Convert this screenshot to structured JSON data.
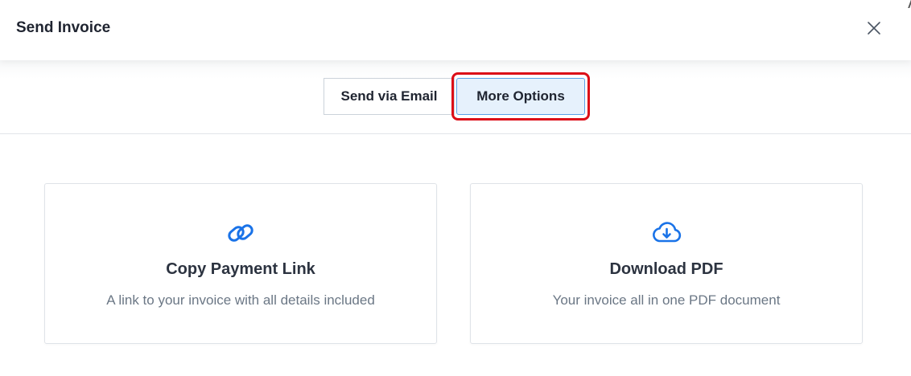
{
  "dialog": {
    "title": "Send Invoice",
    "close_icon": "close-icon"
  },
  "tabs": [
    {
      "label": "Send via Email",
      "selected": false
    },
    {
      "label": "More Options",
      "selected": true
    }
  ],
  "options": [
    {
      "icon": "link-icon",
      "title": "Copy Payment Link",
      "description": "A link to your invoice with all details included"
    },
    {
      "icon": "cloud-download-icon",
      "title": "Download PDF",
      "description": "Your invoice all in one PDF document"
    }
  ],
  "colors": {
    "accent": "#1a73e8",
    "highlight": "#dc0d17",
    "selected_tab_bg": "#e6f1fc"
  }
}
